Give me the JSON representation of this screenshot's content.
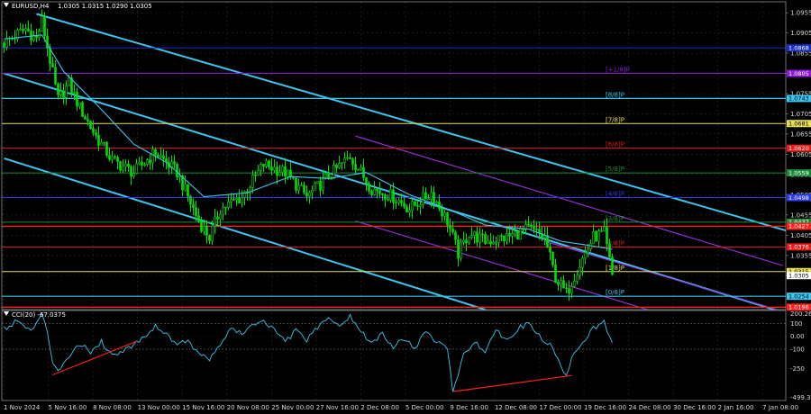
{
  "header": {
    "symbol": "EURUSD,H4",
    "ohlc": "1.0305 1.0315 1.0290 1.0305",
    "indicator": "CCI(20) -67.0375"
  },
  "chart_data": [
    {
      "type": "candlestick",
      "title": "EURUSD,H4",
      "subtitle": "1.0305 1.0315 1.0290 1.0305",
      "ylim": [
        1.0221,
        1.0982
      ],
      "y_ticks": [
        "1.0955",
        "1.0905",
        "1.0855",
        "1.0805",
        "1.0755",
        "1.0705",
        "1.0655",
        "1.0605",
        "1.0555",
        "1.0505",
        "1.0455",
        "1.0405",
        "1.0355",
        "1.0305"
      ],
      "x_ticks": [
        "1 Nov 2024",
        "5 Nov 16:00",
        "8 Nov 08:00",
        "13 Nov 00:00",
        "15 Nov 16:00",
        "20 Nov 08:00",
        "25 Nov 00:00",
        "27 Nov 16:00",
        "2 Dec 08:00",
        "5 Dec 00:00",
        "9 Dec 16:00",
        "12 Dec 08:00",
        "17 Dec 00:00",
        "19 Dec 16:00",
        "24 Dec 08:00",
        "30 Dec 16:00",
        "2 Jan 16:00",
        "7 Jan 08:00"
      ],
      "close_path": [
        {
          "bar": 0,
          "price": 1.088
        },
        {
          "bar": 8,
          "price": 1.0915
        },
        {
          "bar": 12,
          "price": 1.089
        },
        {
          "bar": 14,
          "price": 1.0935
        },
        {
          "bar": 16,
          "price": 1.087
        },
        {
          "bar": 20,
          "price": 1.074
        },
        {
          "bar": 24,
          "price": 1.078
        },
        {
          "bar": 28,
          "price": 1.072
        },
        {
          "bar": 34,
          "price": 1.065
        },
        {
          "bar": 40,
          "price": 1.059
        },
        {
          "bar": 48,
          "price": 1.056
        },
        {
          "bar": 56,
          "price": 1.061
        },
        {
          "bar": 64,
          "price": 1.056
        },
        {
          "bar": 72,
          "price": 1.044
        },
        {
          "bar": 76,
          "price": 1.04
        },
        {
          "bar": 80,
          "price": 1.047
        },
        {
          "bar": 88,
          "price": 1.05
        },
        {
          "bar": 96,
          "price": 1.058
        },
        {
          "bar": 104,
          "price": 1.056
        },
        {
          "bar": 112,
          "price": 1.05
        },
        {
          "bar": 120,
          "price": 1.055
        },
        {
          "bar": 128,
          "price": 1.06
        },
        {
          "bar": 136,
          "price": 1.052
        },
        {
          "bar": 144,
          "price": 1.05
        },
        {
          "bar": 150,
          "price": 1.047
        },
        {
          "bar": 158,
          "price": 1.051
        },
        {
          "bar": 164,
          "price": 1.044
        },
        {
          "bar": 168,
          "price": 1.036
        },
        {
          "bar": 172,
          "price": 1.041
        },
        {
          "bar": 178,
          "price": 1.039
        },
        {
          "bar": 186,
          "price": 1.04
        },
        {
          "bar": 194,
          "price": 1.042
        },
        {
          "bar": 200,
          "price": 1.04
        },
        {
          "bar": 204,
          "price": 1.03
        },
        {
          "bar": 208,
          "price": 1.026
        },
        {
          "bar": 212,
          "price": 1.032
        },
        {
          "bar": 218,
          "price": 1.04
        },
        {
          "bar": 222,
          "price": 1.041
        },
        {
          "bar": 225,
          "price": 1.0305
        }
      ],
      "moving_average": [
        {
          "bar": 0,
          "price": 1.089
        },
        {
          "bar": 14,
          "price": 1.09
        },
        {
          "bar": 22,
          "price": 1.081
        },
        {
          "bar": 34,
          "price": 1.073
        },
        {
          "bar": 48,
          "price": 1.063
        },
        {
          "bar": 60,
          "price": 1.0585
        },
        {
          "bar": 74,
          "price": 1.05
        },
        {
          "bar": 90,
          "price": 1.051
        },
        {
          "bar": 106,
          "price": 1.055
        },
        {
          "bar": 120,
          "price": 1.0545
        },
        {
          "bar": 134,
          "price": 1.056
        },
        {
          "bar": 150,
          "price": 1.0505
        },
        {
          "bar": 164,
          "price": 1.047
        },
        {
          "bar": 178,
          "price": 1.043
        },
        {
          "bar": 194,
          "price": 1.042
        },
        {
          "bar": 206,
          "price": 1.039
        },
        {
          "bar": 216,
          "price": 1.038
        },
        {
          "bar": 225,
          "price": 1.037
        }
      ],
      "channels": [
        {
          "color": "#3cc6ee",
          "p1": {
            "bar": 12,
            "price": 1.0952
          },
          "p2": {
            "bar": 290,
            "price": 1.0415
          }
        },
        {
          "color": "#3cc6ee",
          "p1": {
            "bar": 0,
            "price": 1.0805
          },
          "p2": {
            "bar": 285,
            "price": 1.0221
          }
        },
        {
          "color": "#3cc6ee",
          "p1": {
            "bar": 0,
            "price": 1.0595
          },
          "p2": {
            "bar": 178,
            "price": 1.0221
          }
        },
        {
          "color": "#a030e0",
          "p1": {
            "bar": 130,
            "price": 1.065
          },
          "p2": {
            "bar": 288,
            "price": 1.033
          }
        },
        {
          "color": "#a030e0",
          "p1": {
            "bar": 130,
            "price": 1.044
          },
          "p2": {
            "bar": 238,
            "price": 1.0221
          }
        },
        {
          "color": "#a030e0",
          "p1": {
            "bar": 200,
            "price": 1.039
          },
          "p2": {
            "bar": 286,
            "price": 1.0221
          }
        }
      ],
      "murray_levels": [
        {
          "price": 1.0868,
          "label": "",
          "tag": "1.0868",
          "color": "#1c2cc8"
        },
        {
          "price": 1.0805,
          "label": "[+1/8]P",
          "tag": "1.0805",
          "color": "#8a1cd8"
        },
        {
          "price": 1.0743,
          "label": "[8/8]P",
          "tag": "1.0743",
          "color": "#3cc6ee"
        },
        {
          "price": 1.0681,
          "label": "[7/8]P",
          "tag": "1.0681",
          "color": "#e8e05a"
        },
        {
          "price": 1.062,
          "label": "[6/8]P",
          "tag": "1.0620",
          "color": "#e81c1c"
        },
        {
          "price": 1.0559,
          "label": "[5/8]P",
          "tag": "1.0559",
          "color": "#1c8c3c"
        },
        {
          "price": 1.0498,
          "label": "[4/8]P",
          "tag": "1.0498",
          "color": "#2c3ce8"
        },
        {
          "price": 1.0437,
          "label": "[3/8]P",
          "tag": "1.0437",
          "color": "#1c8c3c"
        },
        {
          "price": 1.0376,
          "label": "[2/8]P",
          "tag": "1.0376",
          "color": "#e81c1c"
        },
        {
          "price": 1.0315,
          "label": "[1/8]P",
          "tag": "1.0315",
          "color": "#e8e05a"
        },
        {
          "price": 1.0254,
          "label": "[0/8]P",
          "tag": "1.0254",
          "color": "#3cc6ee"
        }
      ],
      "extra_lines": [
        {
          "price": 1.0427,
          "color": "#ff2020",
          "tag": "1.0427"
        },
        {
          "price": 1.0227,
          "color": "#ff2020",
          "tag": "1.0196"
        }
      ],
      "current_price": {
        "price": 1.0305,
        "tag": "1.0305"
      }
    },
    {
      "type": "line",
      "title": "CCI(20) -67.0375",
      "ylim": [
        -499.3751,
        200.2665
      ],
      "y_ticks": [
        {
          "value": 200.2665,
          "label": "200.2665"
        },
        {
          "value": 100,
          "label": "100"
        },
        {
          "value": 0,
          "label": "0.00"
        },
        {
          "value": -100,
          "label": "-100"
        },
        {
          "value": -250,
          "label": "-250"
        },
        {
          "value": -499.3751,
          "label": "-499.3751"
        }
      ],
      "levels": [
        100,
        -100
      ],
      "cci": [
        {
          "bar": 0,
          "v": 60
        },
        {
          "bar": 5,
          "v": 120
        },
        {
          "bar": 10,
          "v": 40
        },
        {
          "bar": 14,
          "v": 160
        },
        {
          "bar": 16,
          "v": 40
        },
        {
          "bar": 18,
          "v": -200
        },
        {
          "bar": 20,
          "v": -260
        },
        {
          "bar": 24,
          "v": -150
        },
        {
          "bar": 28,
          "v": -60
        },
        {
          "bar": 32,
          "v": -120
        },
        {
          "bar": 36,
          "v": -40
        },
        {
          "bar": 40,
          "v": -150
        },
        {
          "bar": 46,
          "v": -90
        },
        {
          "bar": 52,
          "v": 0
        },
        {
          "bar": 56,
          "v": 80
        },
        {
          "bar": 60,
          "v": 20
        },
        {
          "bar": 64,
          "v": -60
        },
        {
          "bar": 68,
          "v": -30
        },
        {
          "bar": 72,
          "v": -140
        },
        {
          "bar": 76,
          "v": -180
        },
        {
          "bar": 80,
          "v": -60
        },
        {
          "bar": 84,
          "v": 60
        },
        {
          "bar": 88,
          "v": 20
        },
        {
          "bar": 92,
          "v": 80
        },
        {
          "bar": 96,
          "v": 130
        },
        {
          "bar": 100,
          "v": 40
        },
        {
          "bar": 104,
          "v": -40
        },
        {
          "bar": 108,
          "v": 40
        },
        {
          "bar": 112,
          "v": -30
        },
        {
          "bar": 116,
          "v": 70
        },
        {
          "bar": 120,
          "v": 130
        },
        {
          "bar": 124,
          "v": 90
        },
        {
          "bar": 128,
          "v": 150
        },
        {
          "bar": 132,
          "v": 40
        },
        {
          "bar": 136,
          "v": -60
        },
        {
          "bar": 140,
          "v": 20
        },
        {
          "bar": 144,
          "v": -80
        },
        {
          "bar": 148,
          "v": -20
        },
        {
          "bar": 152,
          "v": -90
        },
        {
          "bar": 156,
          "v": 30
        },
        {
          "bar": 160,
          "v": -40
        },
        {
          "bar": 164,
          "v": -100
        },
        {
          "bar": 166,
          "v": -420
        },
        {
          "bar": 168,
          "v": -300
        },
        {
          "bar": 170,
          "v": -150
        },
        {
          "bar": 174,
          "v": -40
        },
        {
          "bar": 178,
          "v": -110
        },
        {
          "bar": 182,
          "v": 50
        },
        {
          "bar": 186,
          "v": -30
        },
        {
          "bar": 190,
          "v": 60
        },
        {
          "bar": 194,
          "v": 100
        },
        {
          "bar": 198,
          "v": 0
        },
        {
          "bar": 202,
          "v": -70
        },
        {
          "bar": 206,
          "v": -230
        },
        {
          "bar": 208,
          "v": -300
        },
        {
          "bar": 210,
          "v": -180
        },
        {
          "bar": 214,
          "v": -40
        },
        {
          "bar": 218,
          "v": 60
        },
        {
          "bar": 222,
          "v": 110
        },
        {
          "bar": 225,
          "v": -67
        }
      ],
      "divergences": [
        {
          "color": "#ff2020",
          "p1": {
            "bar": 18,
            "v": -300
          },
          "p2": {
            "bar": 49,
            "v": -40
          }
        },
        {
          "color": "#ff2020",
          "p1": {
            "bar": 166,
            "v": -430
          },
          "p2": {
            "bar": 210,
            "v": -305
          }
        }
      ]
    }
  ]
}
